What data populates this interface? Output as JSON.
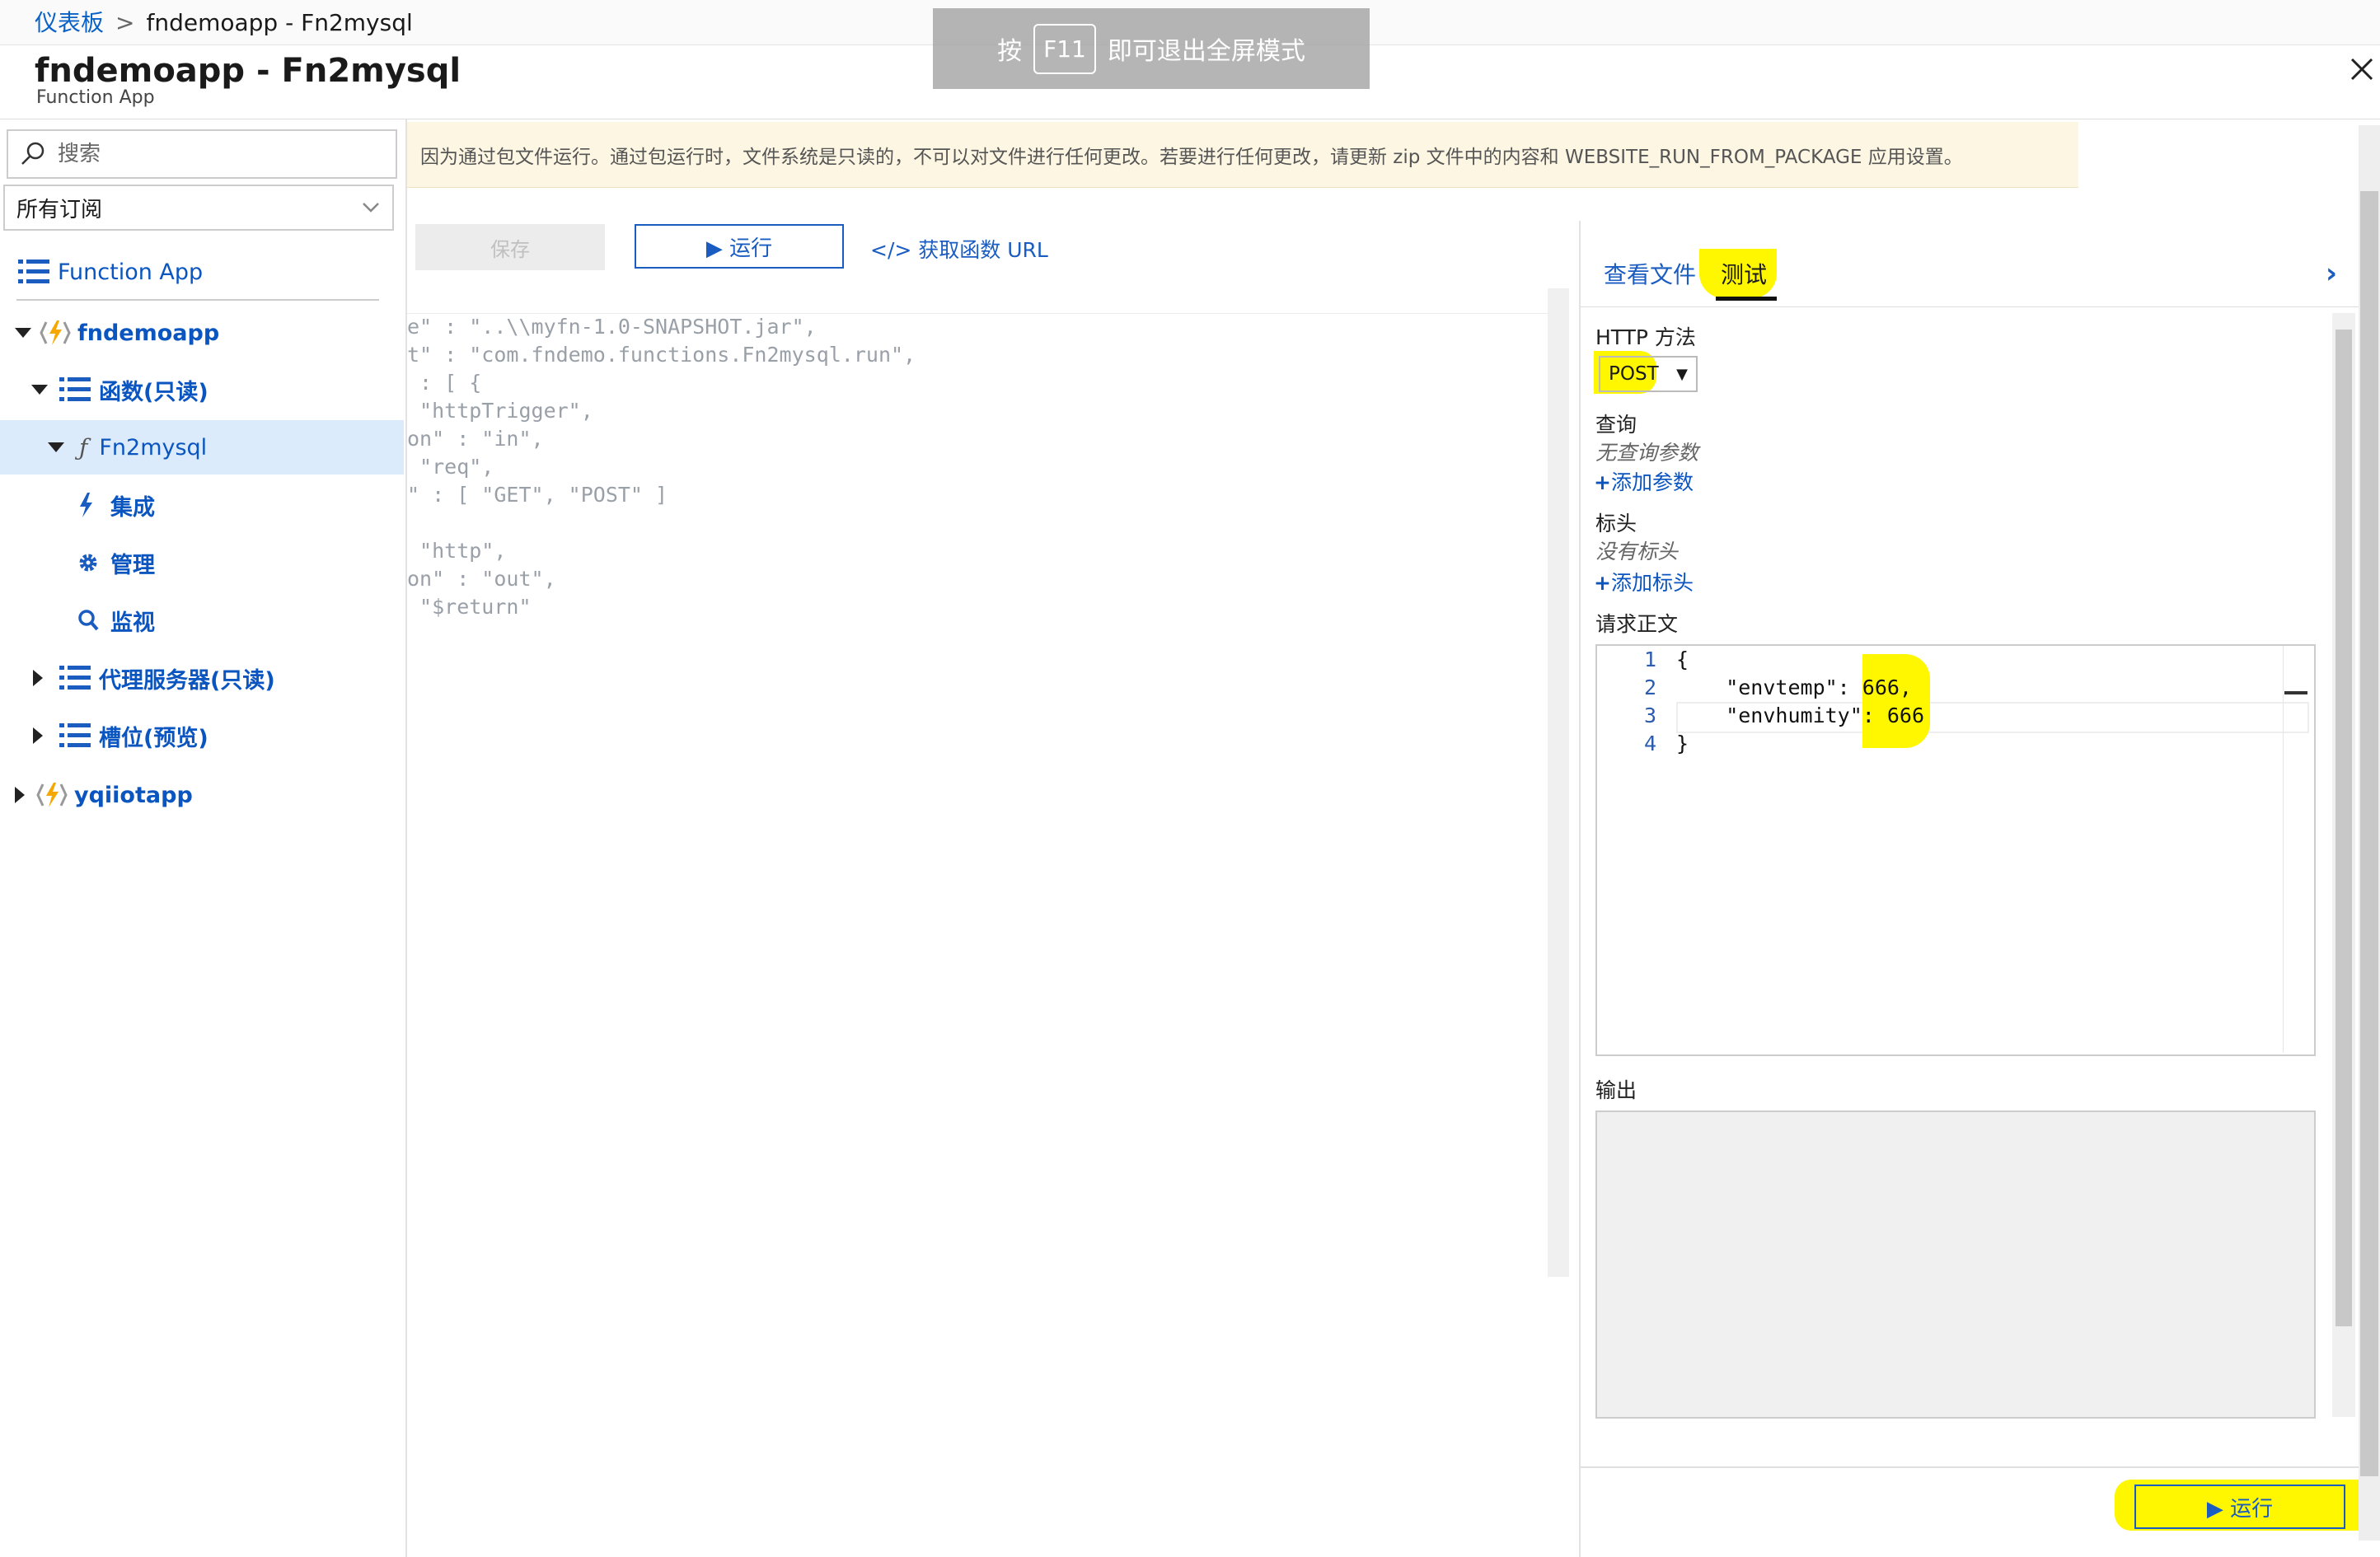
{
  "breadcrumb": {
    "root": "仪表板",
    "current": "fndemoapp - Fn2mysql"
  },
  "fullscreen_hint": {
    "prefix": "按",
    "key": "F11",
    "suffix": "即可退出全屏模式"
  },
  "header": {
    "title": "fndemoapp - Fn2mysql",
    "subtitle": "Function App"
  },
  "sidebar": {
    "search_placeholder": "搜索",
    "subscription": "所有订阅",
    "items": [
      {
        "label": "Function App"
      },
      {
        "label": "fndemoapp"
      },
      {
        "label": "函数(只读)"
      },
      {
        "label": "Fn2mysql"
      },
      {
        "label": "集成"
      },
      {
        "label": "管理"
      },
      {
        "label": "监视"
      },
      {
        "label": "代理服务器(只读)"
      },
      {
        "label": "槽位(预览)"
      },
      {
        "label": "yqiiotapp"
      }
    ]
  },
  "warning": "因为通过包文件运行。通过包运行时，文件系统是只读的，不可以对文件进行任何更改。若要进行任何更改，请更新 zip 文件中的内容和 WEBSITE_RUN_FROM_PACKAGE 应用设置。",
  "toolbar": {
    "save": "保存",
    "run": "▶ 运行",
    "get_url": "</> 获取函数 URL"
  },
  "code_lines": [
    "e\" : \"..\\\\myfn-1.0-SNAPSHOT.jar\",",
    "t\" : \"com.fndemo.functions.Fn2mysql.run\",",
    " : [ {",
    " \"httpTrigger\",",
    "on\" : \"in\",",
    " \"req\",",
    "\" : [ \"GET\", \"POST\" ]",
    "",
    " \"http\",",
    "on\" : \"out\",",
    " \"$return\""
  ],
  "right_panel": {
    "tabs": {
      "files": "查看文件",
      "test": "测试"
    },
    "http_method_label": "HTTP 方法",
    "http_method": "POST",
    "query_label": "查询",
    "query_empty": "无查询参数",
    "add_param": "添加参数",
    "headers_label": "标头",
    "headers_empty": "没有标头",
    "add_header": "添加标头",
    "body_label": "请求正文",
    "body_lines": [
      {
        "n": "1",
        "text": "{"
      },
      {
        "n": "2",
        "text": "    \"envtemp\": 666,"
      },
      {
        "n": "3",
        "text": "    \"envhumity\": 666"
      },
      {
        "n": "4",
        "text": "}"
      }
    ],
    "output_label": "输出",
    "run": "▶ 运行"
  },
  "colors": {
    "accent": "#1a5cc0",
    "highlight": "#fff700",
    "warning_bg": "#fdf6e3"
  }
}
